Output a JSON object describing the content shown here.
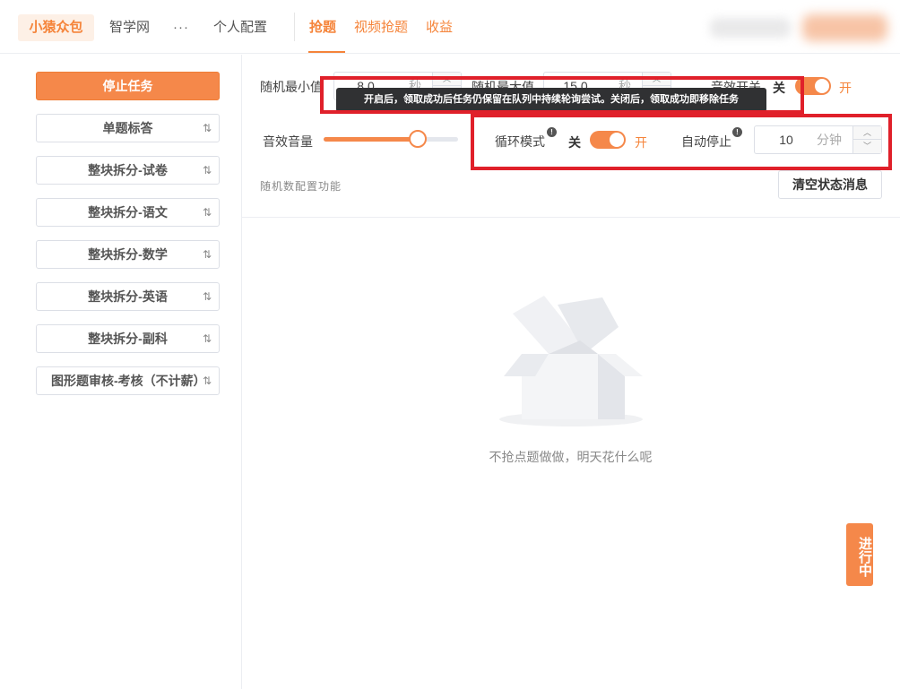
{
  "nav": {
    "brand": "小猿众包",
    "zhixue": "智学网",
    "more": "···",
    "personal": "个人配置"
  },
  "tabs": {
    "grab": "抢题",
    "video_grab": "视频抢题",
    "income": "收益"
  },
  "sidebar": {
    "stop_task": "停止任务",
    "tasks": [
      {
        "label": "单题标答"
      },
      {
        "label": "整块拆分-试卷"
      },
      {
        "label": "整块拆分-语文"
      },
      {
        "label": "整块拆分-数学"
      },
      {
        "label": "整块拆分-英语"
      },
      {
        "label": "整块拆分-副科"
      },
      {
        "label": "图形题审核-考核（不计薪）"
      }
    ],
    "sort_icon": "⇅"
  },
  "settings": {
    "random_min": {
      "label": "随机最小值",
      "value": "8.0",
      "unit": "秒"
    },
    "random_max": {
      "label": "随机最大值",
      "value": "15.0",
      "unit": "秒"
    },
    "sound": {
      "label": "音效开关",
      "off": "关",
      "on": "开",
      "checked": true
    },
    "volume": {
      "label": "音效音量",
      "level": 0.7
    },
    "loop_mode": {
      "label": "循环模式",
      "off": "关",
      "on": "开",
      "checked": true
    },
    "auto_stop": {
      "label": "自动停止",
      "value": "10",
      "unit": "分钟"
    },
    "random_config": "随机数配置功能",
    "clear_btn": "清空状态消息"
  },
  "tooltip": "开启后，领取成功后任务仍保留在队列中持续轮询尝试。关闭后，领取成功即移除任务",
  "empty_state": {
    "message": "不抢点题做做，明天花什么呢"
  },
  "running_badge": "进行中",
  "colors": {
    "accent": "#f5884a",
    "highlight": "#e0202a"
  }
}
